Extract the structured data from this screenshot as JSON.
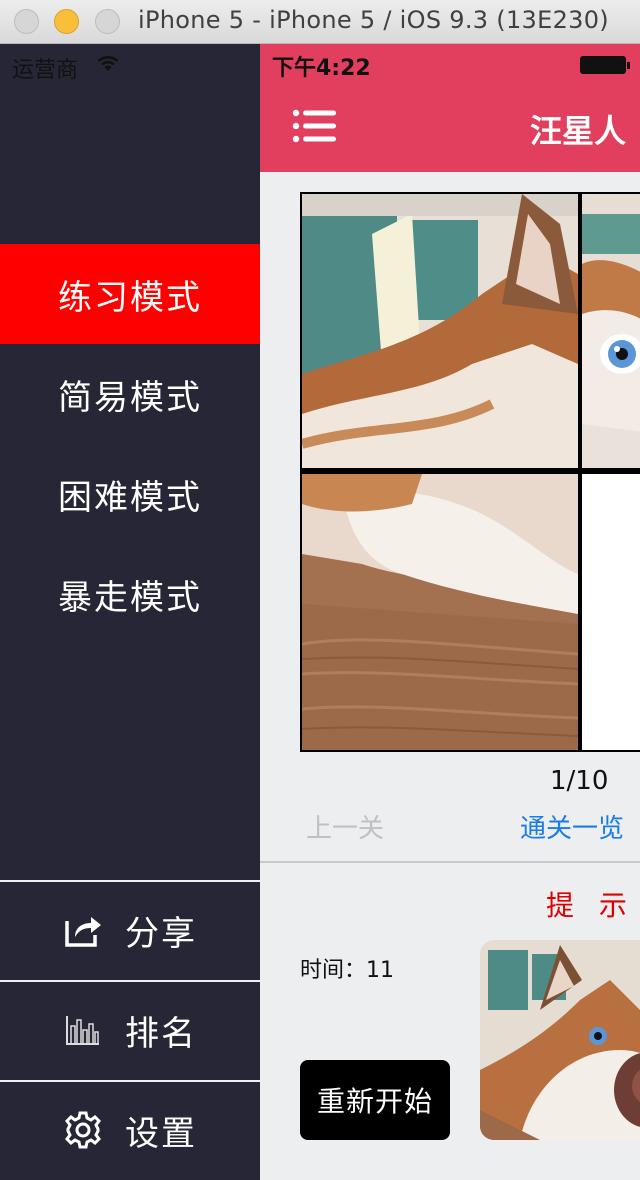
{
  "window": {
    "title": "iPhone 5 - iPhone 5 / iOS 9.3 (13E230)"
  },
  "status": {
    "carrier": "运营商",
    "time": "下午4:22"
  },
  "navbar": {
    "title": "汪星人",
    "menu_icon": "hamburger-menu-icon"
  },
  "drawer": {
    "modes": [
      {
        "label": "练习模式",
        "active": true
      },
      {
        "label": "简易模式",
        "active": false
      },
      {
        "label": "困难模式",
        "active": false
      },
      {
        "label": "暴走模式",
        "active": false
      }
    ],
    "bottom": [
      {
        "label": "分享",
        "icon": "share-icon"
      },
      {
        "label": "排名",
        "icon": "ranking-chart-icon"
      },
      {
        "label": "设置",
        "icon": "gear-icon"
      }
    ],
    "colors": {
      "background": "#262636",
      "active": "#FF0000"
    }
  },
  "game": {
    "level": "1/10",
    "prev_label": "上一关",
    "overview_label": "通关一览",
    "hint_label": "提 示",
    "time_label": "时间：11",
    "restart_label": "重新开始",
    "image_subject": "husky-dog-photo"
  },
  "colors": {
    "navbar": "#E23F5F",
    "link": "#1A7CE8",
    "hint": "#E00000"
  }
}
